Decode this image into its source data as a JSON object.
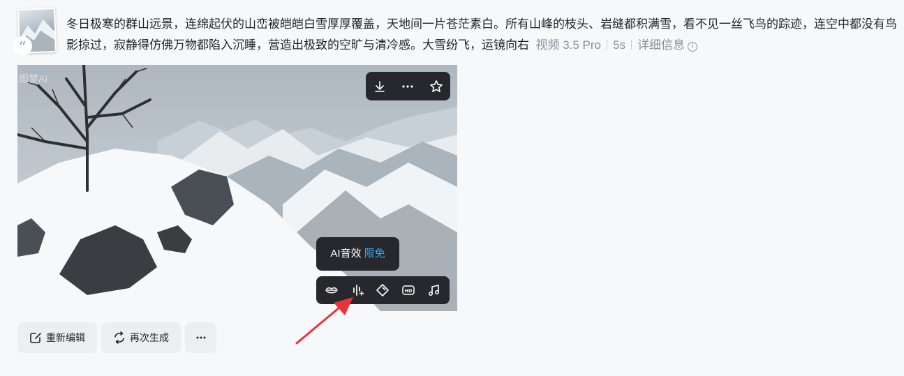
{
  "prompt": {
    "text": "冬日极寒的群山远景，连绵起伏的山峦被皑皑白雪厚厚覆盖，天地间一片苍茫素白。所有山峰的枝头、岩缝都积满雪，看不见一丝飞鸟的踪迹，连空中都没有鸟影掠过，寂静得仿佛万物都陷入沉睡，营造出极致的空旷与清冷感。大雪纷飞，运镜向右",
    "model": "视频 3.5 Pro",
    "duration": "5s",
    "details_label": "详细信息"
  },
  "video": {
    "watermark": "即梦AI"
  },
  "tooltip": {
    "label": "AI音效",
    "promo": "限免"
  },
  "actions": {
    "reedit_label": "重新编辑",
    "regenerate_label": "再次生成"
  },
  "icons": {
    "quote": "quote-icon",
    "info": "info-icon",
    "download": "download-icon",
    "more": "more-icon",
    "star": "star-icon",
    "lip": "lip-sync-icon",
    "sound": "ai-sound-effect-icon",
    "diamond": "enhance-icon",
    "hd": "hd-icon",
    "music": "music-icon",
    "edit": "edit-icon",
    "refresh": "refresh-icon"
  },
  "colors": {
    "accent": "#3aa6f5",
    "arrow": "#e8323c",
    "toolbar_bg": "#26282d"
  }
}
